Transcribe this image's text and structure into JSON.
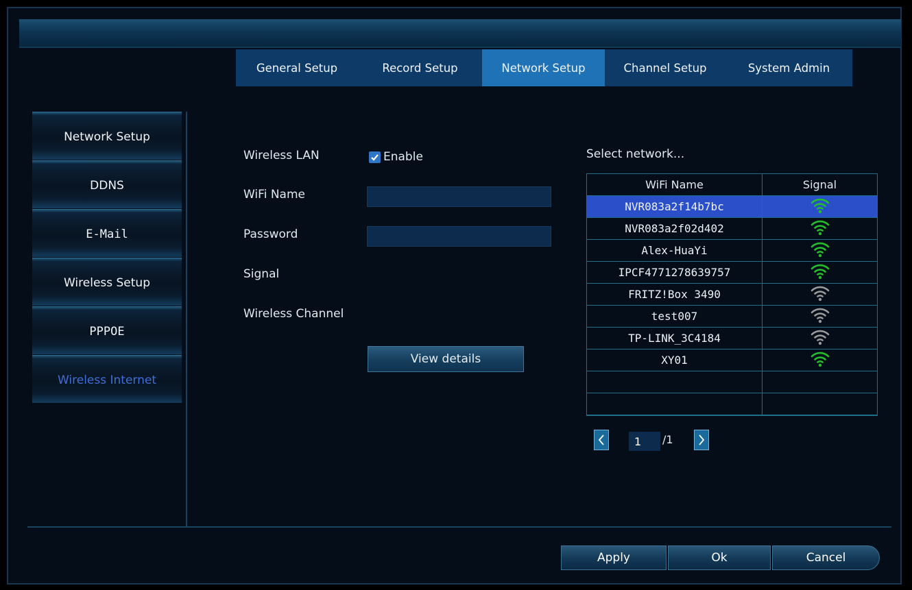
{
  "nav": {
    "tabs": [
      {
        "label": "General Setup"
      },
      {
        "label": "Record Setup"
      },
      {
        "label": "Network Setup"
      },
      {
        "label": "Channel Setup"
      },
      {
        "label": "System Admin"
      }
    ],
    "active_tab": "Network Setup"
  },
  "sidebar": {
    "items": [
      {
        "label": "Network Setup"
      },
      {
        "label": "DDNS"
      },
      {
        "label": "E-Mail"
      },
      {
        "label": "Wireless Setup"
      },
      {
        "label": "PPPOE"
      },
      {
        "label": "Wireless Internet"
      }
    ],
    "active_item": "Wireless Internet"
  },
  "form": {
    "wireless_lan_label": "Wireless LAN",
    "enable_label": "Enable",
    "enable_checked": true,
    "wifi_name_label": "WiFi Name",
    "wifi_name_value": "",
    "password_label": "Password",
    "password_value": "",
    "signal_label": "Signal",
    "wireless_channel_label": "Wireless Channel",
    "view_details_label": "View details"
  },
  "networks": {
    "select_label": "Select network...",
    "columns": [
      "WiFi Name",
      "Signal"
    ],
    "rows": [
      {
        "name": "NVR083a2f14b7bc",
        "signal_icon": "wifi-icon",
        "color": "#22c02a",
        "selected": true
      },
      {
        "name": "NVR083a2f02d402",
        "signal_icon": "wifi-icon",
        "color": "#22c02a"
      },
      {
        "name": "Alex-HuaYi",
        "signal_icon": "wifi-icon",
        "color": "#22c02a"
      },
      {
        "name": "IPCF4771278639757",
        "signal_icon": "wifi-icon",
        "color": "#22c02a"
      },
      {
        "name": "FRITZ!Box 3490",
        "signal_icon": "wifi-icon",
        "color": "#9a9a9a"
      },
      {
        "name": "test007",
        "signal_icon": "wifi-icon",
        "color": "#9a9a9a"
      },
      {
        "name": "TP-LINK_3C4184",
        "signal_icon": "wifi-icon",
        "color": "#9a9a9a"
      },
      {
        "name": "XY01",
        "signal_icon": "wifi-icon",
        "color": "#22c02a"
      }
    ],
    "empty_rows": 2
  },
  "pagination": {
    "current_page": "1",
    "total_pages": "/1"
  },
  "buttons": {
    "apply": "Apply",
    "ok": "Ok",
    "cancel": "Cancel"
  },
  "colors": {
    "selected_row": "#2b4fc8",
    "active_tab": "#1f72b6",
    "active_sidebar_text": "#3f6fd8"
  }
}
